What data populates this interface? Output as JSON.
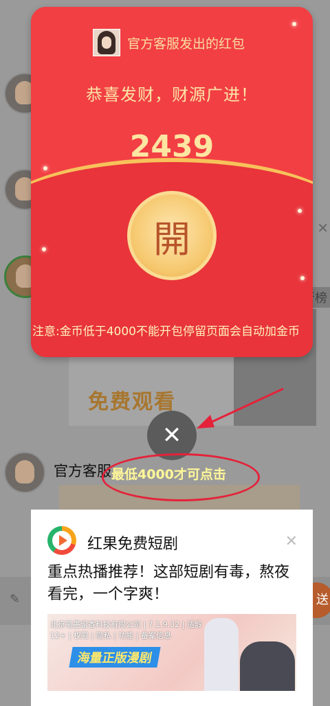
{
  "background": {
    "contact_name": "官方客服",
    "side_label": "行榜",
    "free_watch_label": "免费观看",
    "send_label": "送"
  },
  "envelope": {
    "sender": "官方客服发出的红包",
    "greeting": "恭喜发财，财源广进！",
    "amount": "2439",
    "open_glyph": "開",
    "notice": "注意:金币低于4000不能开包停留页面会自动加金币"
  },
  "overlay": {
    "close_glyph": "✕",
    "hint": "最低4000才可点击"
  },
  "ad": {
    "app_name": "红果免费短剧",
    "headline": "重点热播推荐！这部短剧有毒，熬夜看完，一个字爽！",
    "compliance": "北京笔墨留香科技有限公司 | 7.1.9.32 | 适龄12+ | 权限 | 隐私 | 功能 | 备案信息",
    "slogan": "海量正版漫剧",
    "close_glyph": "✕"
  },
  "colors": {
    "envelope_red": "#ef3e3d",
    "gold": "#f7c25b",
    "annotation_red": "#e4223a"
  }
}
